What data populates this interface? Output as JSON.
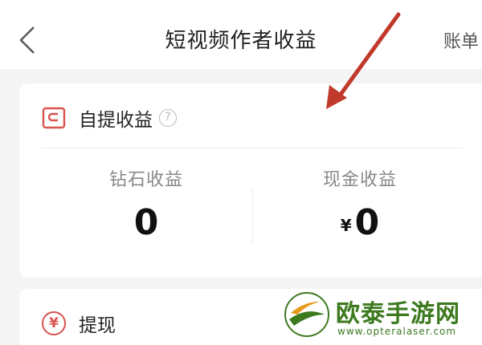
{
  "header": {
    "title": "短视频作者收益",
    "right_link": "账单"
  },
  "income_card": {
    "title": "自提收益",
    "help_glyph": "?",
    "diamond": {
      "label": "钻石收益",
      "value": "0"
    },
    "cash": {
      "label": "现金收益",
      "currency": "¥",
      "value": "0"
    }
  },
  "withdraw_card": {
    "title": "提现",
    "icon_glyph": "¥"
  },
  "watermark": {
    "name": "欧泰手游网",
    "url": "www.opteralaser.com"
  },
  "colors": {
    "accent": "#d9534f",
    "arrow": "#c0392b",
    "watermark": "#3d7a1f"
  }
}
